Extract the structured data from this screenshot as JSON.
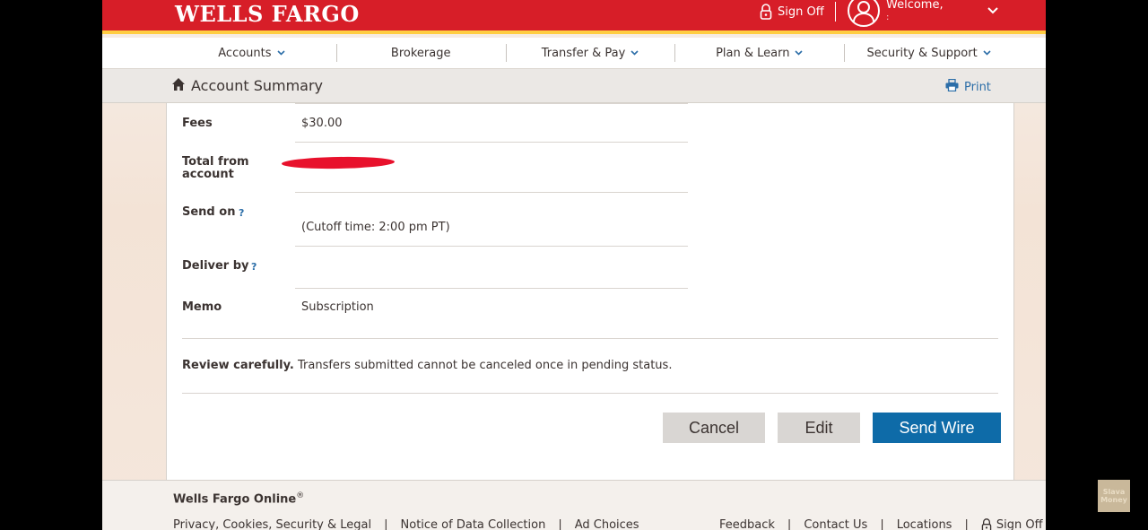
{
  "header": {
    "logo": "WELLS FARGO",
    "sign_off": "Sign Off",
    "welcome": "Welcome,",
    "welcome_sub": ":"
  },
  "nav": {
    "items": [
      {
        "label": "Accounts",
        "has_dropdown": true
      },
      {
        "label": "Brokerage",
        "has_dropdown": false
      },
      {
        "label": "Transfer & Pay",
        "has_dropdown": true
      },
      {
        "label": "Plan & Learn",
        "has_dropdown": true
      },
      {
        "label": "Security & Support",
        "has_dropdown": true
      }
    ]
  },
  "subheader": {
    "title": "Account Summary",
    "print": "Print"
  },
  "details": {
    "fees_label": "Fees",
    "fees_value": "$30.00",
    "total_label_1": "Total from",
    "total_label_2": "account",
    "send_on_label": "Send on",
    "cutoff": "(Cutoff time: 2:00 pm PT)",
    "deliver_by_label": "Deliver by",
    "memo_label": "Memo",
    "memo_value": "Subscription",
    "help": "?"
  },
  "review": {
    "bold": "Review carefully.",
    "text": " Transfers submitted cannot be canceled once in pending status."
  },
  "buttons": {
    "cancel": "Cancel",
    "edit": "Edit",
    "send": "Send Wire"
  },
  "footer": {
    "title": "Wells Fargo Online",
    "reg": "®",
    "left_links": [
      "Privacy, Cookies, Security & Legal",
      "Notice of Data Collection",
      "Ad Choices"
    ],
    "right_links": [
      "Feedback",
      "Contact Us",
      "Locations",
      "Sign Off"
    ]
  },
  "watermark": "Slava Money",
  "colors": {
    "brand_red": "#d71e28",
    "brand_gold": "#ffcd41",
    "primary_button": "#0e6ba8",
    "link": "#2c6ea8"
  }
}
